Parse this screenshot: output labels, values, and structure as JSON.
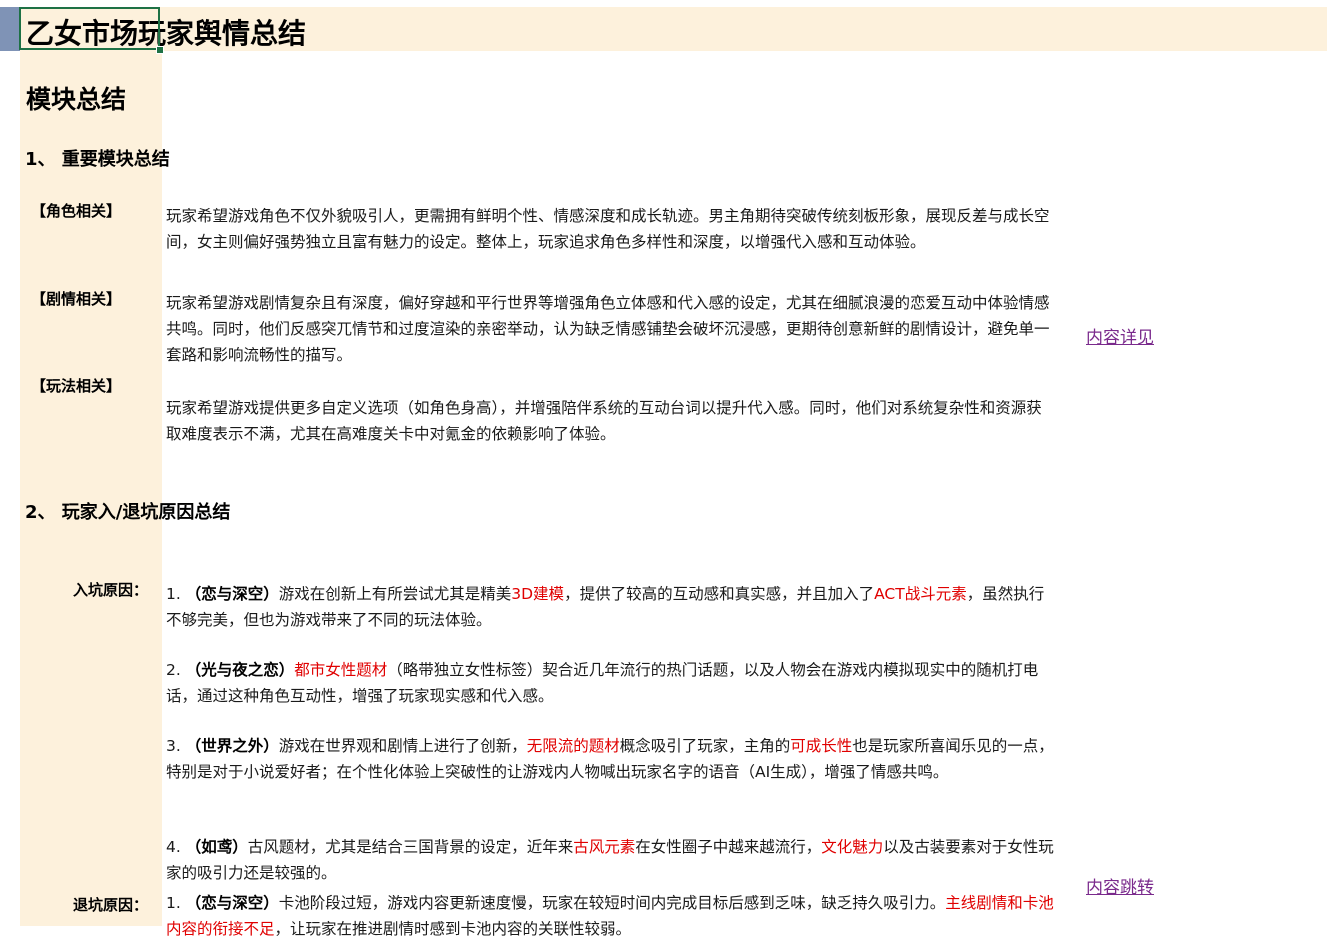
{
  "title": "乙女市场玩家舆情总结",
  "section_title": "模块总结",
  "section1": {
    "heading": "1、 重要模块总结",
    "rows": [
      {
        "label": "【角色相关】",
        "text": "玩家希望游戏角色不仅外貌吸引人，更需拥有鲜明个性、情感深度和成长轨迹。男主角期待突破传统刻板形象，展现反差与成长空间，女主则偏好强势独立且富有魅力的设定。整体上，玩家追求角色多样性和深度，以增强代入感和互动体验。"
      },
      {
        "label": "【剧情相关】",
        "text": "玩家希望游戏剧情复杂且有深度，偏好穿越和平行世界等增强角色立体感和代入感的设定，尤其在细腻浪漫的恋爱互动中体验情感共鸣。同时，他们反感突兀情节和过度渲染的亲密举动，认为缺乏情感铺垫会破坏沉浸感，更期待创意新鲜的剧情设计，避免单一套路和影响流畅性的描写。"
      },
      {
        "label": "【玩法相关】",
        "text": "玩家希望游戏提供更多自定义选项（如角色身高），并增强陪伴系统的互动台词以提升代入感。同时，他们对系统复杂性和资源获取难度表示不满，尤其在高难度关卡中对氪金的依赖影响了体验。"
      }
    ],
    "link": "内容详见"
  },
  "section2": {
    "heading": "2、 玩家入/退坑原因总结",
    "enter_label": "入坑原因：",
    "enter": [
      {
        "n": "1. ",
        "game": "（恋与深空）",
        "s1": "游戏在创新上有所尝试尤其是精美",
        "r1": "3D建模",
        "s2": "，提供了较高的互动感和真实感，并且加入了",
        "r2": "ACT战斗元素",
        "s3": "，虽然执行不够完美，但也为游戏带来了不同的玩法体验。"
      },
      {
        "n": " 2. ",
        "game": "（光与夜之恋）",
        "r1": "都市女性题材",
        "s1": "（略带独立女性标签）契合近几年流行的热门话题，以及人物会在游戏内模拟现实中的随机打电话，通过这种角色互动性，增强了玩家现实感和代入感。"
      },
      {
        "n": " 3. ",
        "game": "（世界之外）",
        "s1": "游戏在世界观和剧情上进行了创新，",
        "r1": "无限流的题材",
        "s2": "概念吸引了玩家，主角的",
        "r2": "可成长性",
        "s3": "也是玩家所喜闻乐见的一点，特别是对于小说爱好者；在个性化体验上突破性的让游戏内人物喊出玩家名字的语音（AI生成），增强了情感共鸣。"
      },
      {
        "n": " 4. ",
        "game": "（如鸢）",
        "s1": "古风题材，尤其是结合三国背景的设定，近年来",
        "r1": "古风元素",
        "s2": "在女性圈子中越来越流行，",
        "r2": "文化魅力",
        "s3": "以及古装要素对于女性玩家的吸引力还是较强的。"
      }
    ],
    "exit_label": "退坑原因：",
    "exit": [
      {
        "n": "1. ",
        "game": "（恋与深空）",
        "s1": "卡池阶段过短，游戏内容更新速度慢，玩家在较短时间内完成目标后感到乏味，缺乏持久吸引力。",
        "r1": "主线剧情和卡池内容的衔接不足",
        "s2": "，让玩家在推进剧情时感到卡池内容的关联性较弱。"
      }
    ],
    "link": "内容跳转"
  },
  "colors": {
    "accent_red": "#e00000",
    "link": "#7a2a8c",
    "band": "#fdf1dc",
    "selection": "#1e7145"
  }
}
